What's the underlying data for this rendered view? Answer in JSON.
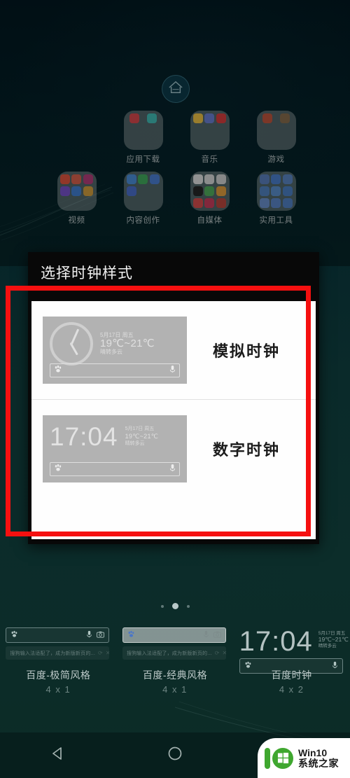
{
  "colors": {
    "annotation_red": "#f51010",
    "dialog_bg": "#080808",
    "list_bg": "#fefefe",
    "widget_preview_gray": "#b2b2b2",
    "watermark_green": "#3fa72f",
    "wallpaper_teal": "#0c2d2a"
  },
  "homescreen": {
    "home_button_icon": "home-icon",
    "folders": [
      {
        "label": "应用下载",
        "icon_colors": [
          "#e0454a",
          "#3fbfb8"
        ]
      },
      {
        "label": "音乐",
        "icon_colors": [
          "#f5c542",
          "#6a7fd8",
          "#e03b3b"
        ]
      },
      {
        "label": "游戏",
        "icon_colors": [
          "#c4523a",
          "#8a6b4a"
        ]
      },
      {
        "label": "",
        "icon_colors": []
      },
      {
        "label": "视频",
        "icon_colors": [
          "#e8523c",
          "#e0604a",
          "#b83a7a",
          "#7a4fd0",
          "#3f7fd8",
          "#d8a03a"
        ]
      },
      {
        "label": "内容创作",
        "icon_colors": [
          "#4a8fe0",
          "#3fae5a",
          "#4a7fd8",
          "#4a6fd0"
        ]
      },
      {
        "label": "自媒体",
        "icon_colors": [
          "#e8e8e8",
          "#dedede",
          "#d8d8d8",
          "#222222",
          "#4fb05a",
          "#e8a03a",
          "#e04a4a",
          "#d03a5a",
          "#c0443a"
        ]
      },
      {
        "label": "实用工具",
        "icon_colors": [
          "#5a7fc0",
          "#4a7fd0",
          "#5a86c8",
          "#4f82c4",
          "#5a8fd0",
          "#4a7fc8",
          "#6a90d0",
          "#5a85cc",
          "#4f80c8"
        ]
      }
    ]
  },
  "dialog": {
    "title": "选择时钟样式",
    "items": [
      {
        "name": "模拟时钟",
        "preview_type": "analog",
        "time": "",
        "date": "5月17日 周五",
        "temperature": "19℃~21℃",
        "weather": "晴转多云",
        "search_left_icon": "baidu-paw-icon",
        "search_right_icon": "microphone-icon"
      },
      {
        "name": "数字时钟",
        "preview_type": "digital",
        "time": "17:04",
        "date": "5月17日 周五",
        "temperature": "19℃~21℃",
        "weather": "晴转多云",
        "search_left_icon": "baidu-paw-icon",
        "search_right_icon": "microphone-icon"
      }
    ]
  },
  "page_indicator": {
    "total": 3,
    "active_index": 1
  },
  "widget_picker": {
    "items": [
      {
        "label": "百度-极简风格",
        "size": "4 x 1",
        "type": "searchbar",
        "suggestion": "搜狗输入法适配了，成为新版新页的...",
        "left_icon": "baidu-paw-icon",
        "right_icons": [
          "microphone-icon",
          "camera-icon"
        ],
        "suggestion_icons": [
          "refresh-icon",
          "close-icon"
        ]
      },
      {
        "label": "百度-经典风格",
        "size": "4 x 1",
        "type": "searchbar-filled",
        "suggestion": "搜狗输入法适配了，成为新版新页的...",
        "left_icon": "baidu-logo-icon",
        "right_icons": [
          "microphone-icon",
          "camera-icon"
        ],
        "suggestion_icons": [
          "refresh-icon",
          "close-icon"
        ]
      },
      {
        "label": "百度时钟",
        "size": "4 x 2",
        "type": "clock",
        "time": "17:04",
        "date": "5月17日 周五",
        "temperature": "19℃~21℃",
        "weather": "晴转多云",
        "left_icon": "baidu-paw-icon",
        "right_icons": [
          "microphone-icon"
        ]
      }
    ]
  },
  "navbar": {
    "buttons": [
      {
        "name": "back-button",
        "icon": "triangle-back-icon"
      },
      {
        "name": "home-button",
        "icon": "circle-home-icon"
      },
      {
        "name": "recents-button",
        "icon": "square-recents-icon"
      }
    ]
  },
  "watermark": {
    "line1": "Win10",
    "line2": "系统之家",
    "logo": "win10-logo-icon"
  }
}
